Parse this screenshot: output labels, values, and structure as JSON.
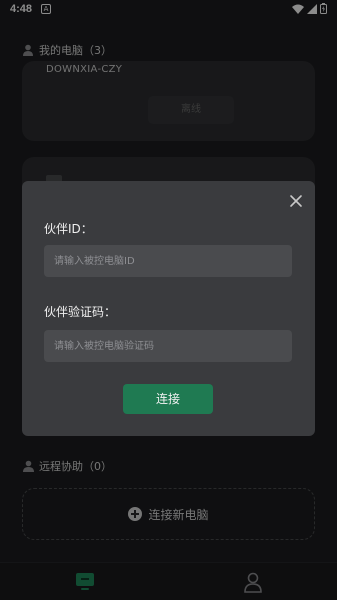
{
  "status_bar": {
    "time": "4:48",
    "notification_icon": "A"
  },
  "my_computers": {
    "title": "我的电脑（3）",
    "items": [
      {
        "name": "DOWNXIA-CZY",
        "status_button": "离线"
      }
    ]
  },
  "remote_assist": {
    "title": "远程协助（0）",
    "add_label": "连接新电脑"
  },
  "dialog": {
    "partner_id_label": "伙伴ID：",
    "partner_id_placeholder": "请输入被控电脑ID",
    "verification_label": "伙伴验证码：",
    "verification_placeholder": "请输入被控电脑验证码",
    "connect_label": "连接"
  },
  "colors": {
    "accent": "#1f7a52",
    "background": "#1c1d1f",
    "dialog": "#3a3b3e"
  },
  "icons": [
    "user-icon",
    "group-icon",
    "close-icon",
    "plus-circle-icon",
    "monitor-icon",
    "profile-icon",
    "wifi-icon",
    "signal-icon",
    "battery-icon"
  ]
}
